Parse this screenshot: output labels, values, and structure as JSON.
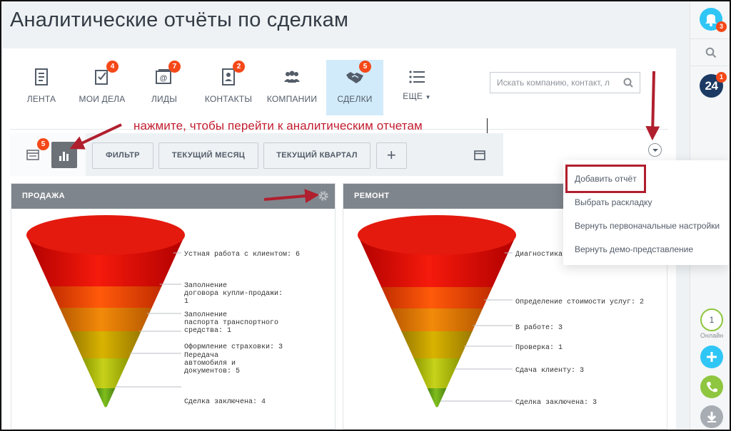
{
  "page": {
    "title": "Аналитические отчёты по сделкам"
  },
  "nav": {
    "items": [
      {
        "label": "ЛЕНТА",
        "icon": "feed-icon",
        "badge": ""
      },
      {
        "label": "МОИ ДЕЛА",
        "icon": "tasks-icon",
        "badge": "4"
      },
      {
        "label": "ЛИДЫ",
        "icon": "leads-icon",
        "badge": "7"
      },
      {
        "label": "КОНТАКТЫ",
        "icon": "contacts-icon",
        "badge": "2"
      },
      {
        "label": "КОМПАНИИ",
        "icon": "companies-icon",
        "badge": ""
      },
      {
        "label": "СДЕЛКИ",
        "icon": "deals-icon",
        "badge": "5",
        "active": true
      },
      {
        "label": "ЕЩЕ",
        "icon": "more-icon",
        "badge": ""
      }
    ]
  },
  "search": {
    "placeholder": "Искать компанию, контакт, л"
  },
  "hint": "нажмите, чтобы перейти к аналитическим отчетам",
  "toolbar": {
    "badge": "5",
    "filter_label": "ФИЛЬТР",
    "month_label": "ТЕКУЩИЙ МЕСЯЦ",
    "quarter_label": "ТЕКУЩИЙ КВАРТАЛ",
    "add_label": "+"
  },
  "menu": {
    "items": [
      "Добавить отчёт",
      "Выбрать раскладку",
      "Вернуть первоначальные настройки",
      "Вернуть демо-представление"
    ]
  },
  "panels": [
    {
      "title": "ПРОДАЖА",
      "stages": [
        {
          "lines": [
            "Устная работа с клиентом: 6"
          ],
          "value": 6
        },
        {
          "lines": [
            "Заполнение",
            "договора купли-продажи:",
            "1"
          ],
          "value": 1
        },
        {
          "lines": [
            "Заполнение",
            "паспорта транспортного",
            "средства: 1"
          ],
          "value": 1
        },
        {
          "lines": [
            "Оформление страховки: 3"
          ],
          "value": 3
        },
        {
          "lines": [
            "Передача",
            "автомобиля и",
            "документов: 5"
          ],
          "value": 5
        },
        {
          "lines": [
            "Сделка заключена: 4"
          ],
          "value": 4
        }
      ]
    },
    {
      "title": "РЕМОНТ",
      "stages": [
        {
          "lines": [
            "Диагностика"
          ],
          "value": null
        },
        {
          "lines": [
            "Определение стоимости услуг: 2"
          ],
          "value": 2
        },
        {
          "lines": [
            "В работе: 3"
          ],
          "value": 3
        },
        {
          "lines": [
            "Проверка: 1"
          ],
          "value": 1
        },
        {
          "lines": [
            "Сдача клиенту: 3"
          ],
          "value": 3
        },
        {
          "lines": [
            "Сделка заключена: 3"
          ],
          "value": 3
        }
      ]
    }
  ],
  "rail": {
    "bell_badge": "3",
    "b24_label": "24",
    "b24_badge": "1",
    "online_count": "1",
    "online_label": "Онлайн"
  },
  "colors": {
    "accent": "#2fc6f6",
    "badge": "#f54819",
    "annotation": "#b01f2e",
    "active_tab": "#d2ebfa",
    "panel_header": "#7f858c"
  }
}
